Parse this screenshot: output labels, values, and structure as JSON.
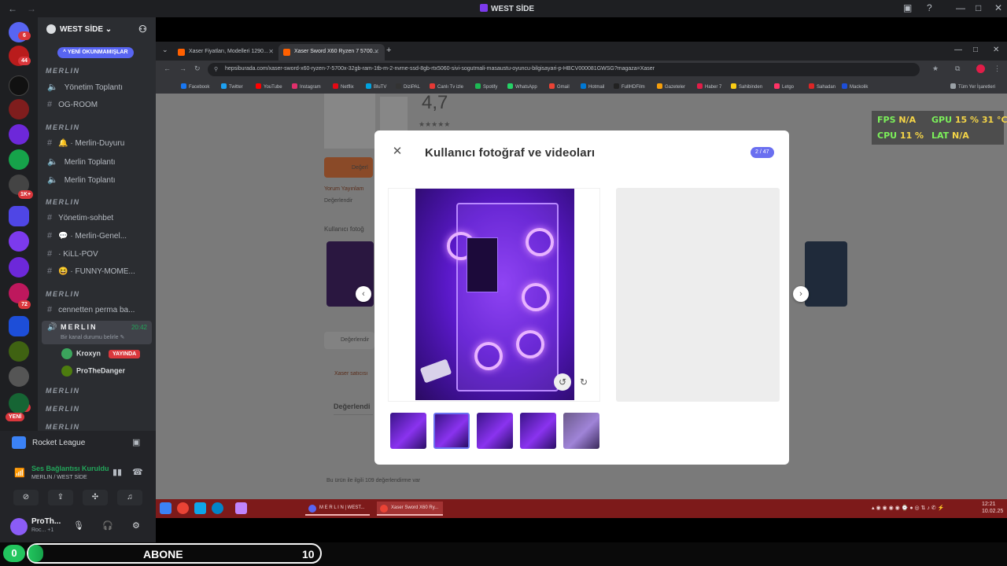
{
  "discord": {
    "window_title": "WEST SİDE",
    "guild_name": "WEST SİDE",
    "new_unread_label": "YENİ OKUNMAMIŞLAR",
    "rail_badges": [
      "6",
      "44",
      "1K+",
      "72",
      "46"
    ],
    "rail_new_label": "YENİ",
    "categories": [
      "MERLIN",
      "MERLIN",
      "MERLIN",
      "MERLIN",
      "MERLIN",
      "MERLIN",
      "MERLIN"
    ],
    "channels": {
      "c1": "Yönetim Toplantı",
      "c2": "OG-ROOM",
      "c3": "🔔 · Merlin-Duyuru",
      "c4": "Merlin Toplantı",
      "c5": "Merlin Toplantı",
      "c6": "Yönetim-sohbet",
      "c7": "💬 · Merlin-Genel...",
      "c8": "· KiLL-POV",
      "c9": "😆 · FUNNY-MOME...",
      "c10": "cennetten perma ba..."
    },
    "active_voice": {
      "name": "MERLIN",
      "time": "20:42",
      "status": "Bir kanal durumu belirle ✎"
    },
    "voice_users": [
      {
        "name": "Kroxyn",
        "badge": "YAYINDA"
      },
      {
        "name": "ProTheDanger"
      }
    ],
    "activity_label": "Rocket League",
    "voice_connected": "Ses Bağlantısı Kuruldu",
    "voice_server": "MERLIN / WEST SİDE",
    "user_name": "ProTh...",
    "user_status": "Roc... +1"
  },
  "browser": {
    "tabs": [
      {
        "title": "Xaser Fiyatları, Modelleri 1290..."
      },
      {
        "title": "Xaser Sword X60 Ryzen 7 5700..."
      }
    ],
    "url": "hepsiburada.com/xaser-sword-x60-ryzen-7-5700x-32gb-ram-1tb-m-2-nvme-ssd-8gb-rtx5060-sivi-sogutmali-masaustu-oyuncu-bilgisayari-p-HBCV000081GWSG?magaza=Xaser",
    "bookmarks": [
      "Facebook",
      "Twitter",
      "YouTube",
      "Instagram",
      "Netflix",
      "BluTV",
      "DiziPAL",
      "Canlı Tv izle",
      "Spotify",
      "WhatsApp",
      "Gmail",
      "Hotmail",
      "FullHDFilm",
      "Gazeteler",
      "Haber 7",
      "Sahibinden",
      "Letgo",
      "Sahadan",
      "Mackolik",
      "Tüm Yer İşaretleri"
    ],
    "bookmark_colors": [
      "#1877f2",
      "#1da1f2",
      "#ff0000",
      "#e1306c",
      "#e50914",
      "#00a3e0",
      "#333333",
      "#e53935",
      "#1db954",
      "#25d366",
      "#ea4335",
      "#0078d4",
      "#222222",
      "#f59e0b",
      "#e11d48",
      "#facc15",
      "#ff3366",
      "#dc2626",
      "#1d4ed8",
      "#9aa0a6"
    ]
  },
  "page": {
    "rating": "4,7",
    "btn_partial": "Değerl",
    "review_title": "Kullanıcı fotoğ",
    "line_yorum": "Yorum Yayınlam",
    "line_deger": "Değerlendir",
    "search_partial": "Değerlendir",
    "line_xaser": "Xaser  satıcısı",
    "degerlendir_head": "Değerlendi",
    "bottom_text": "Bu ürün ile ilgili 109 değerlendirme var"
  },
  "modal": {
    "title": "Kullanıcı fotoğraf ve videoları",
    "counter": "2 / 47",
    "close_icon": "close-icon",
    "selected_thumb_index": 1,
    "thumb_count": 5
  },
  "hud": {
    "fps_label": "FPS",
    "fps_value": "N/A",
    "gpu_label": "GPU",
    "gpu_value": "15 %",
    "gpu_temp": "31 °C",
    "cpu_label": "CPU",
    "cpu_value": "11 %",
    "lat_label": "LAT",
    "lat_value": "N/A"
  },
  "taskbar": {
    "app1": "M E R L I N | WEST...",
    "app2": "Xaser Sword X60 Ry...",
    "clock_time": "12:21",
    "clock_date": "10.02.25"
  },
  "stream": {
    "count": "0",
    "label": "ABONE",
    "goal": "10",
    "progress": 0.05
  }
}
